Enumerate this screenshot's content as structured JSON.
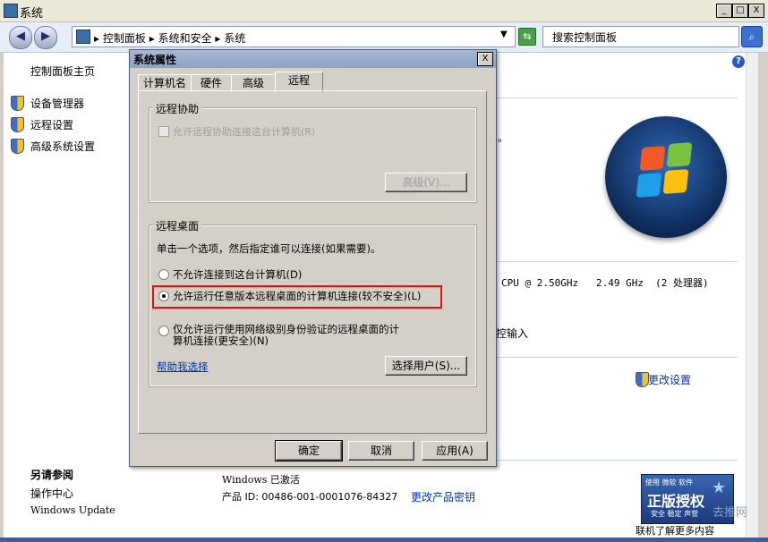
{
  "window": {
    "title": "系统",
    "buttons": {
      "minimize": "_",
      "maximize": "□",
      "close": "X"
    }
  },
  "address": {
    "crumbs": [
      "控制面板",
      "系统和安全",
      "系统"
    ],
    "separator": "▸",
    "search_placeholder": "搜索控制面板"
  },
  "sidebar": {
    "home": "控制面板主页",
    "items": [
      {
        "label": "设备管理器",
        "icon": "shield-icon"
      },
      {
        "label": "远程设置",
        "icon": "shield-icon"
      },
      {
        "label": "高级系统设置",
        "icon": "shield-icon"
      }
    ],
    "see_also_title": "另请参阅",
    "see_also": [
      "操作中心",
      "Windows Update"
    ]
  },
  "main": {
    "fragment_period": "。",
    "cpu_text": "CPU @ 2.50GHz   2.49 GHz  (2 处理器)",
    "touch_text": "控输入",
    "change_settings": "更改设置",
    "activation": "Windows 已激活",
    "product_id": "产品 ID: 00486-001-0001076-84327",
    "change_key": "更改产品密钥",
    "genuine": {
      "line1": "使用 微软 软件",
      "line2": "正版授权",
      "line3": "安全 稳定 声誉",
      "below": "联机了解更多内容"
    },
    "watermark": "去推网"
  },
  "dialog": {
    "title": "系统属性",
    "close": "X",
    "tabs": [
      "计算机名",
      "硬件",
      "高级",
      "远程"
    ],
    "active_tab": "远程",
    "assistance": {
      "title": "远程协助",
      "checkbox": "允许远程协助连接这台计算机(R)",
      "checked": false,
      "advanced_btn": "高级(V)..."
    },
    "desktop": {
      "title": "远程桌面",
      "instruction": "单击一个选项，然后指定谁可以连接(如果需要)。",
      "options": [
        "不允许连接到这台计算机(D)",
        "允许运行任意版本远程桌面的计算机连接(较不安全)(L)",
        "仅允许运行使用网络级别身份验证的远程桌面的计算机连接(更安全)(N)"
      ],
      "selected_index": 1,
      "option3_line1": "仅允许运行使用网络级别身份验证的远程桌面的计",
      "option3_line2": "算机连接(更安全)(N)",
      "help_link": "帮助我选择",
      "select_users_btn": "选择用户(S)..."
    },
    "buttons": {
      "ok": "确定",
      "cancel": "取消",
      "apply": "应用(A)"
    }
  }
}
